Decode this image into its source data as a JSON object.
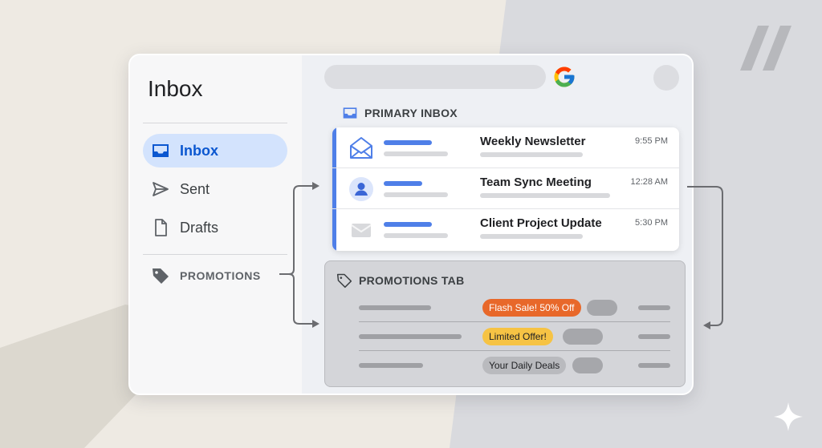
{
  "sidebar": {
    "title": "Inbox",
    "items": [
      {
        "label": "Inbox",
        "icon": "inbox-icon"
      },
      {
        "label": "Sent",
        "icon": "send-icon"
      },
      {
        "label": "Drafts",
        "icon": "draft-icon"
      },
      {
        "label": "PROMOTIONS",
        "icon": "tag-icon"
      }
    ]
  },
  "primary": {
    "heading": "PRIMARY INBOX",
    "emails": [
      {
        "subject": "Weekly Newsletter",
        "time": "9:55 PM",
        "icon": "open-envelope-icon"
      },
      {
        "subject": "Team Sync Meeting",
        "time": "12:28 AM",
        "icon": "person-avatar-icon"
      },
      {
        "subject": "Client Project Update",
        "time": "5:30 PM",
        "icon": "envelope-icon"
      }
    ]
  },
  "promotions": {
    "heading": "PROMOTIONS TAB",
    "rows": [
      {
        "badge": "Flash Sale! 50% Off"
      },
      {
        "badge": "Limited Offer!"
      },
      {
        "badge": "Your Daily Deals"
      }
    ]
  },
  "colors": {
    "accent_blue": "#4f7fe8",
    "active_bg": "#d3e3fd",
    "badge_orange": "#e8682a",
    "badge_yellow": "#f6c344"
  }
}
